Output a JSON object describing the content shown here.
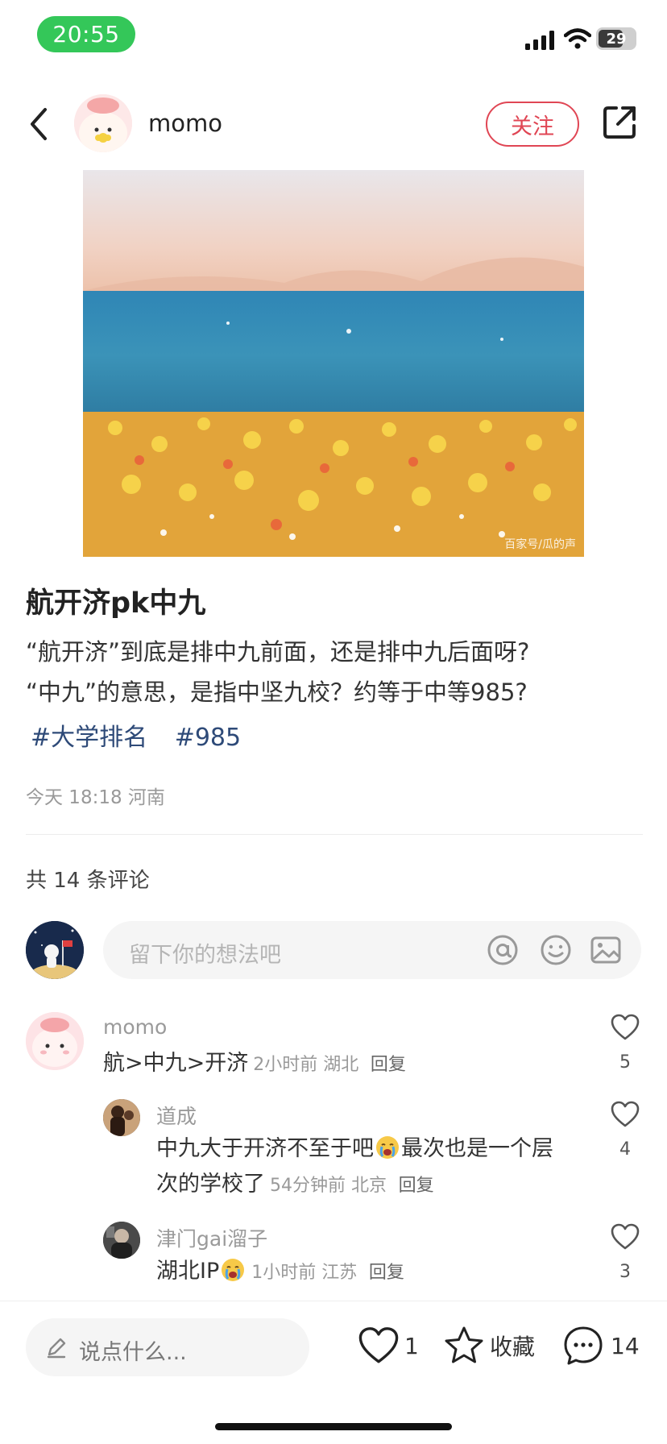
{
  "status_bar": {
    "time": "20:55",
    "battery": "29"
  },
  "header": {
    "author": "momo",
    "follow_label": "关注"
  },
  "post": {
    "image_watermark": "百家号/瓜的声",
    "title": "航开济pk中九",
    "body_lines": [
      "“航开济”到底是排中九前面，还是排中九后面呀?",
      "“中九”的意思，是指中坚九校？约等于中等985?"
    ],
    "tags": [
      "#大学排名",
      "#985"
    ],
    "meta": "今天 18:18 河南"
  },
  "comments_section": {
    "count_label": "共 14 条评论",
    "input_placeholder": "留下你的想法吧"
  },
  "comments": [
    {
      "name": "momo",
      "text": "航>中九>开济",
      "meta": "2小时前 湖北",
      "reply": "回复",
      "likes": "5"
    },
    {
      "name": "道成",
      "text_line1": "中九大于开济不至于吧",
      "text_line1_b": "最次也是一个层",
      "text_line2": "次的学校了",
      "meta": "54分钟前 北京",
      "reply": "回复",
      "likes": "4"
    },
    {
      "name": "津门gai溜子",
      "text": "湖北IP",
      "meta": "1小时前 江苏",
      "reply": "回复",
      "likes": "3"
    }
  ],
  "bottom_bar": {
    "input_placeholder": "说点什么...",
    "like_count": "1",
    "collect_label": "收藏",
    "comment_count": "14"
  }
}
